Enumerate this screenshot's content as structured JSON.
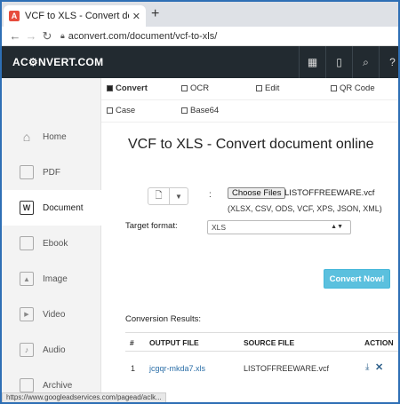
{
  "browser": {
    "tab_title": "VCF to XLS - Convert document",
    "tab_favicon": "A",
    "url": "aconvert.com/document/vcf-to-xls/"
  },
  "header": {
    "logo": "AC⚙NVERT.COM",
    "icons": [
      "grid-icon",
      "tablet-icon",
      "search-icon",
      "help-icon"
    ]
  },
  "sidebar": {
    "items": [
      {
        "label": "Home",
        "icon": "home-icon"
      },
      {
        "label": "PDF",
        "icon": "pdf-icon"
      },
      {
        "label": "Document",
        "icon": "document-icon",
        "active": true
      },
      {
        "label": "Ebook",
        "icon": "ebook-icon"
      },
      {
        "label": "Image",
        "icon": "image-icon"
      },
      {
        "label": "Video",
        "icon": "video-icon"
      },
      {
        "label": "Audio",
        "icon": "audio-icon"
      },
      {
        "label": "Archive",
        "icon": "archive-icon"
      }
    ]
  },
  "tabs": [
    {
      "label": "Convert",
      "active": true
    },
    {
      "label": "OCR"
    },
    {
      "label": "Edit"
    },
    {
      "label": "QR Code"
    },
    {
      "label": "Case"
    },
    {
      "label": "Base64"
    }
  ],
  "main": {
    "heading": "VCF to XLS - Convert document online",
    "colon": ":",
    "choose_button": "Choose Files",
    "file_name": "LISTOFFREEWARE.vcf",
    "formats_hint": "(XLSX, CSV, ODS, VCF, XPS, JSON, XML)",
    "target_label": "Target format:",
    "target_value": "XLS",
    "convert_button": "Convert Now!",
    "results_label": "Conversion Results:"
  },
  "table": {
    "headers": [
      "#",
      "OUTPUT FILE",
      "SOURCE FILE",
      "ACTION"
    ],
    "rows": [
      {
        "index": "1",
        "output": "jcgqr-mkda7.xls",
        "source": "LISTOFFREEWARE.vcf"
      }
    ]
  },
  "status_bar": "https://www.googleadservices.com/pagead/aclk..."
}
